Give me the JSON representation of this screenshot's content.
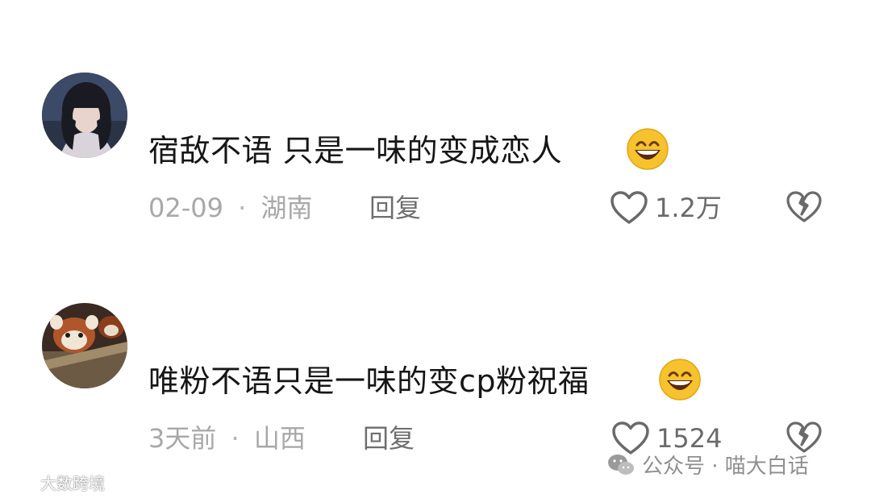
{
  "comments": [
    {
      "text": "宿敌不语 只是一味的变成恋人",
      "date": "02-09",
      "separator": "·",
      "location": "湖南",
      "reply_label": "回复",
      "like_count": "1.2万",
      "avatar_icon": "avatar-girl-photo",
      "emoji_icon": "grinning-face-emoji"
    },
    {
      "text": "唯粉不语只是一味的变cp粉祝福",
      "date": "3天前",
      "separator": "·",
      "location": "山西",
      "reply_label": "回复",
      "like_count": "1524",
      "avatar_icon": "avatar-red-panda-photo",
      "emoji_icon": "grinning-face-emoji"
    }
  ],
  "watermarks": {
    "left": "大数跨境",
    "right": "公众号 · 喵大白话"
  },
  "colors": {
    "text": "#161616",
    "meta": "#a8a8a8",
    "action": "#6e6e6e",
    "emoji_face": "#f6c22e"
  }
}
